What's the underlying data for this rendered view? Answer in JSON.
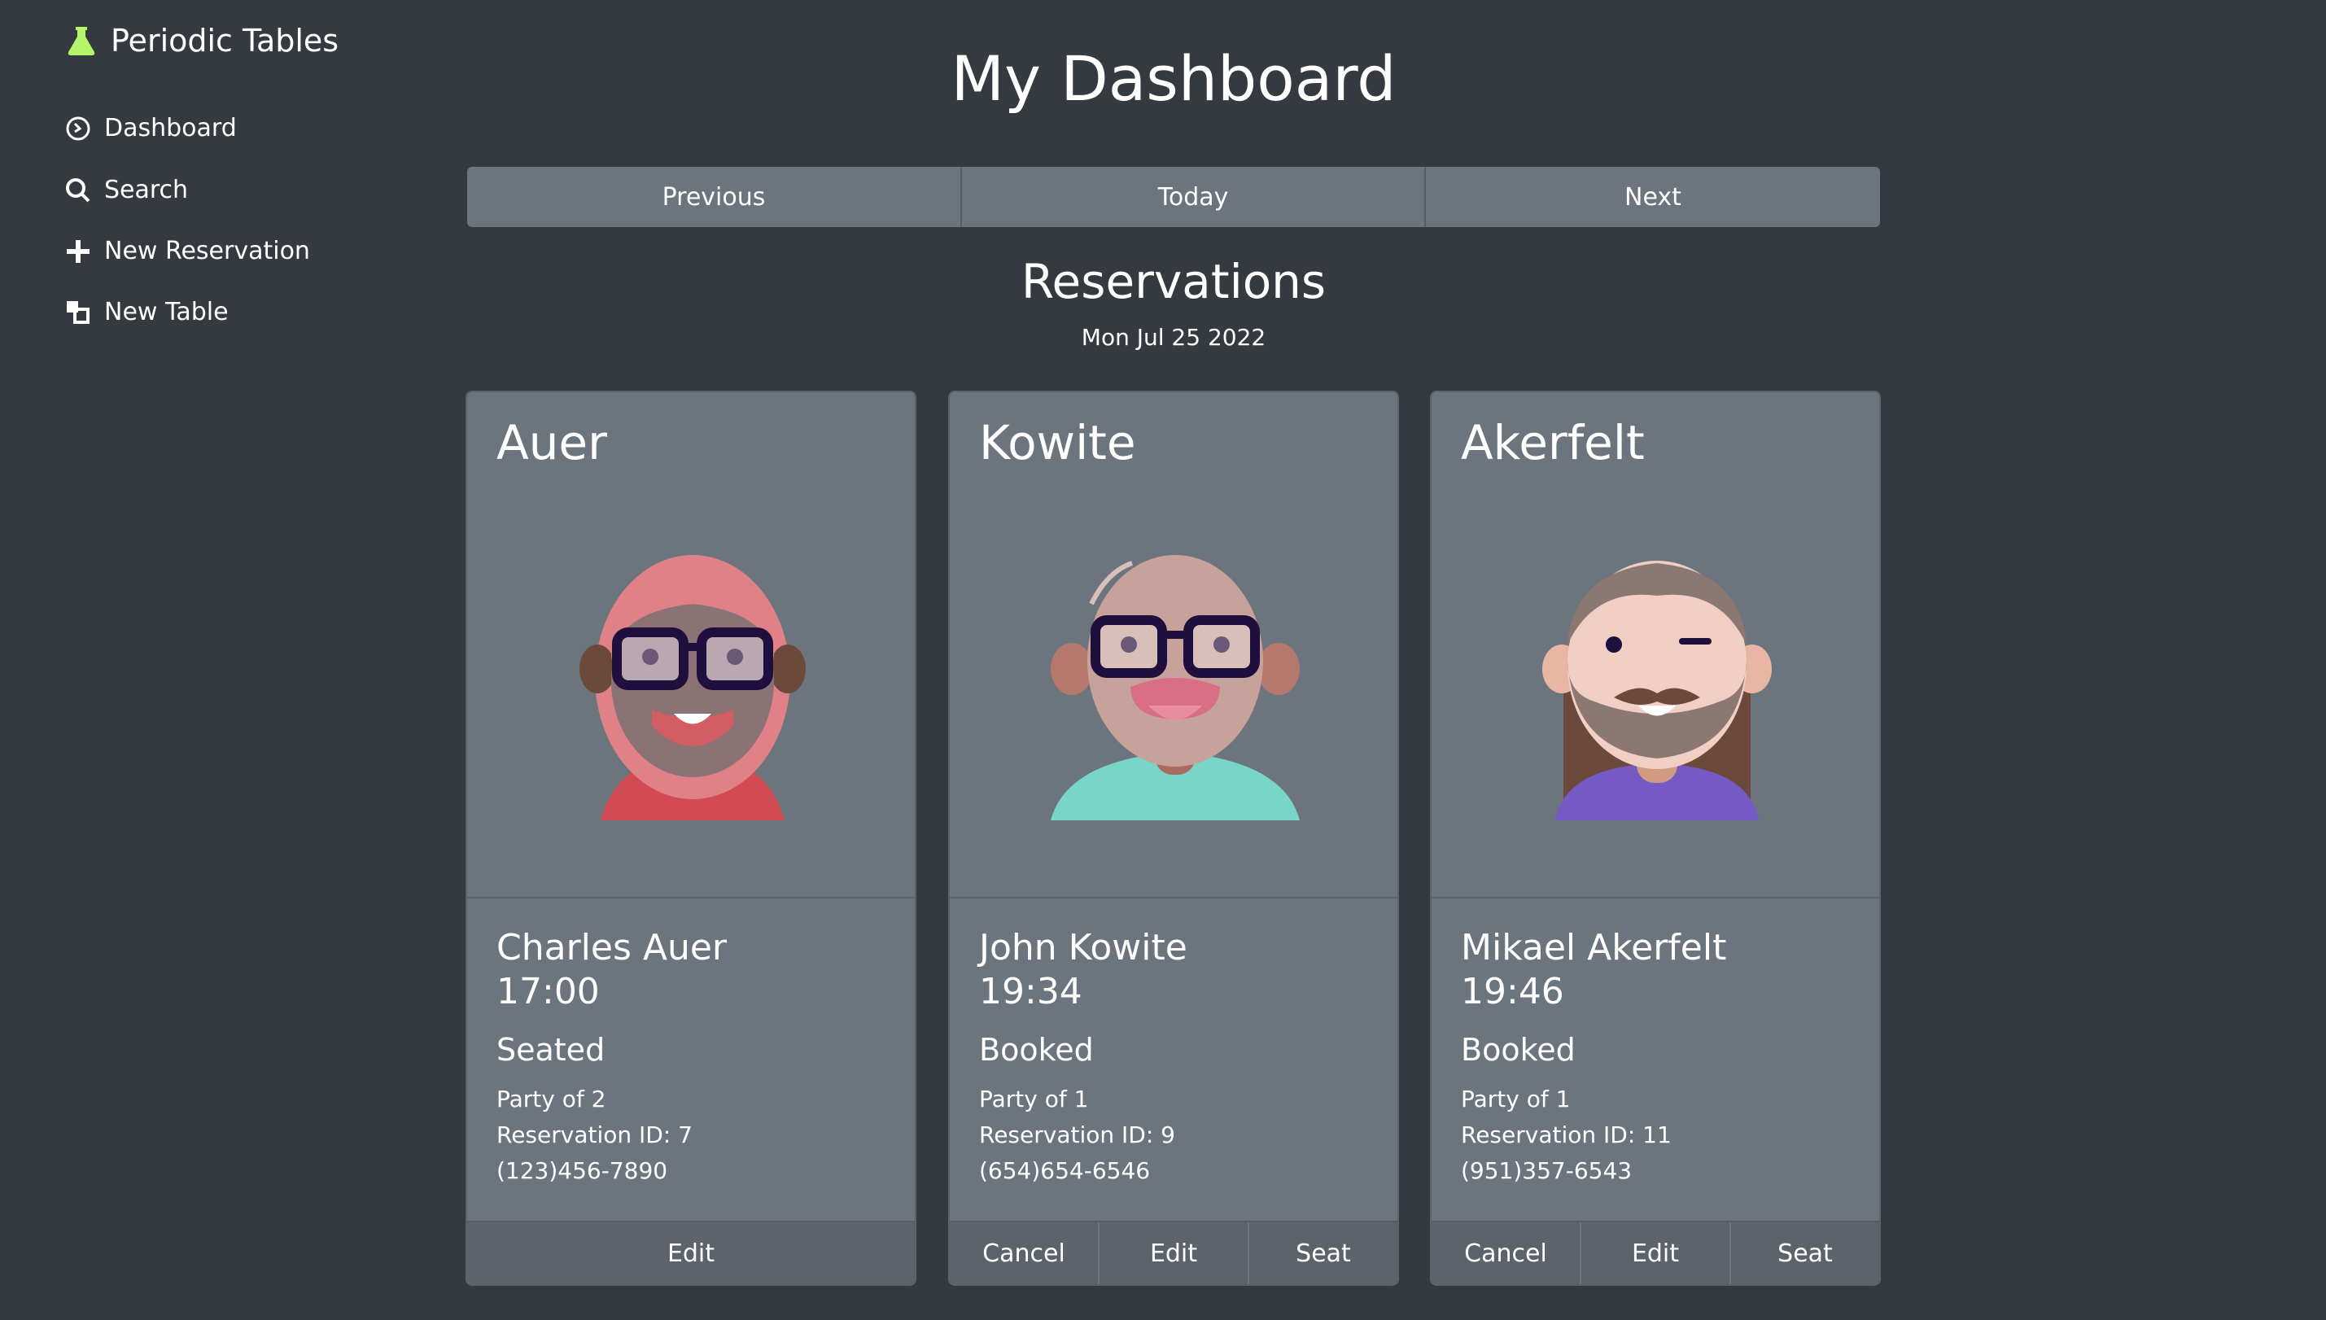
{
  "sidebar": {
    "brand": "Periodic Tables",
    "items": [
      {
        "label": "Dashboard",
        "icon": "dashboard-icon"
      },
      {
        "label": "Search",
        "icon": "search-icon"
      },
      {
        "label": "New Reservation",
        "icon": "plus-icon"
      },
      {
        "label": "New Table",
        "icon": "table-icon"
      }
    ]
  },
  "main": {
    "title": "My Dashboard",
    "date_nav": {
      "previous": "Previous",
      "today": "Today",
      "next": "Next"
    },
    "section_title": "Reservations",
    "date": "Mon Jul 25 2022",
    "reservations": [
      {
        "last_name": "Auer",
        "full_name": "Charles Auer",
        "time": "17:00",
        "status": "Seated",
        "party": "Party of 2",
        "reservation_id": "Reservation ID: 7",
        "phone": "(123)456-7890",
        "actions": [
          "Edit"
        ]
      },
      {
        "last_name": "Kowite",
        "full_name": "John Kowite",
        "time": "19:34",
        "status": "Booked",
        "party": "Party of 1",
        "reservation_id": "Reservation ID: 9",
        "phone": "(654)654-6546",
        "actions": [
          "Cancel",
          "Edit",
          "Seat"
        ]
      },
      {
        "last_name": "Akerfelt",
        "full_name": "Mikael Akerfelt",
        "time": "19:46",
        "status": "Booked",
        "party": "Party of 1",
        "reservation_id": "Reservation ID: 11",
        "phone": "(951)357-6543",
        "actions": [
          "Cancel",
          "Edit",
          "Seat"
        ]
      }
    ]
  },
  "colors": {
    "background": "#343a40",
    "card": "#6c757d",
    "brand_icon": "#b5f56a"
  }
}
